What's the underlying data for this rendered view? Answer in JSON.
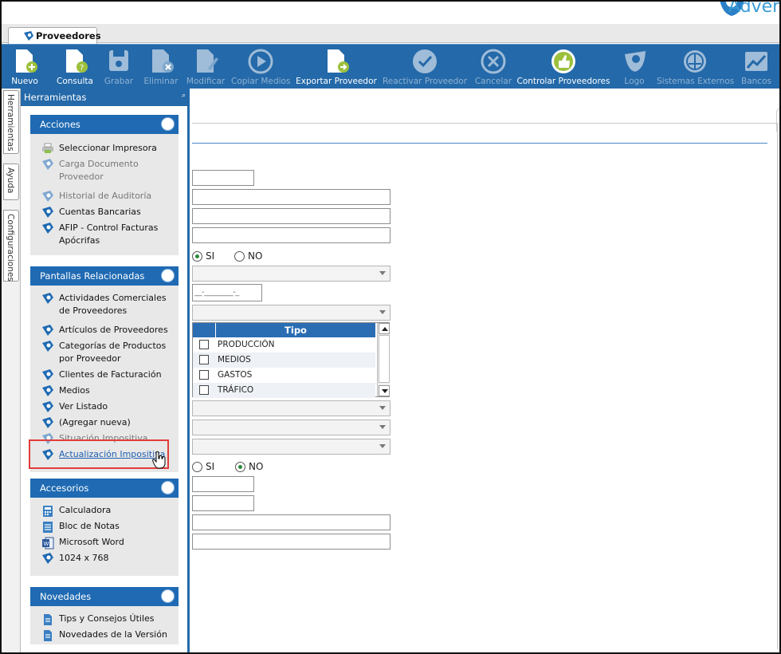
{
  "brand": {
    "logo_text": "Adver"
  },
  "window_tab": {
    "label": "Proveedores"
  },
  "toolbar": [
    {
      "label": "Nuevo",
      "icon": "doc-add-icon",
      "enabled": true
    },
    {
      "label": "Consulta",
      "icon": "doc-query-icon",
      "enabled": true
    },
    {
      "label": "Grabar",
      "icon": "save-icon",
      "enabled": false
    },
    {
      "label": "Eliminar",
      "icon": "doc-delete-icon",
      "enabled": false
    },
    {
      "label": "Modificar",
      "icon": "doc-edit-icon",
      "enabled": false
    },
    {
      "label": "Copiar Medios",
      "icon": "play-icon",
      "enabled": false
    },
    {
      "label": "Exportar Proveedor",
      "icon": "doc-export-icon",
      "enabled": true
    },
    {
      "label": "Reactivar Proveedor",
      "icon": "check-icon",
      "enabled": false
    },
    {
      "label": "Cancelar",
      "icon": "cancel-icon",
      "enabled": false
    },
    {
      "label": "Controlar Proveedores",
      "icon": "thumbs-up-icon",
      "enabled": true
    },
    {
      "label": "Logo",
      "icon": "logo-icon",
      "enabled": false
    },
    {
      "label": "Sistemas Externos",
      "icon": "external-systems-icon",
      "enabled": false
    },
    {
      "label": "Bancos",
      "icon": "chart-icon",
      "enabled": false
    }
  ],
  "side_tabs": [
    "Herramientas",
    "Ayuda",
    "Configuraciones"
  ],
  "panel": {
    "title": "Herramientas",
    "groups": [
      {
        "title": "Acciones",
        "items": [
          {
            "label": "Seleccionar Impresora",
            "enabled": true,
            "icon": "printer-icon"
          },
          {
            "label": "Carga Documento Proveedor",
            "enabled": false,
            "icon": "app-icon"
          },
          {
            "label": "Historial de Auditoría",
            "enabled": false,
            "icon": "app-icon"
          },
          {
            "label": "Cuentas Bancarias",
            "enabled": true,
            "icon": "app-icon"
          },
          {
            "label": "AFIP - Control Facturas Apócrifas",
            "enabled": true,
            "icon": "app-icon"
          }
        ]
      },
      {
        "title": "Pantallas Relacionadas",
        "items": [
          {
            "label": "Actividades Comerciales de Proveedores",
            "enabled": true,
            "icon": "app-icon"
          },
          {
            "label": "Artículos de Proveedores",
            "enabled": true,
            "icon": "app-icon"
          },
          {
            "label": "Categorías de Productos por Proveedor",
            "enabled": true,
            "icon": "app-icon"
          },
          {
            "label": "Clientes de Facturación",
            "enabled": true,
            "icon": "app-icon"
          },
          {
            "label": "Medios",
            "enabled": true,
            "icon": "app-icon"
          },
          {
            "label": "Ver Listado",
            "enabled": true,
            "icon": "app-icon"
          },
          {
            "label": "(Agregar nueva)",
            "enabled": true,
            "icon": "app-icon"
          },
          {
            "label": "Situación Impositiva",
            "enabled": false,
            "icon": "app-icon"
          },
          {
            "label": "Actualización Impositiva",
            "enabled": true,
            "icon": "app-icon",
            "link": true
          }
        ]
      },
      {
        "title": "Accesorios",
        "items": [
          {
            "label": "Calculadora",
            "enabled": true,
            "icon": "calculator-icon"
          },
          {
            "label": "Bloc de Notas",
            "enabled": true,
            "icon": "notepad-icon"
          },
          {
            "label": "Microsoft Word",
            "enabled": true,
            "icon": "word-icon"
          },
          {
            "label": "1024 x 768",
            "enabled": true,
            "icon": "app-icon"
          }
        ]
      },
      {
        "title": "Novedades",
        "items": [
          {
            "label": "Tips y Consejos Útiles",
            "enabled": true,
            "icon": "document-icon"
          },
          {
            "label": "Novedades de la Versión",
            "enabled": true,
            "icon": "document-icon"
          }
        ]
      }
    ]
  },
  "form": {
    "radio1": {
      "options": [
        "SI",
        "NO"
      ],
      "selected": "SI"
    },
    "radio2": {
      "options": [
        "SI",
        "NO"
      ],
      "selected": "NO"
    },
    "masked_input": "__-________-_",
    "tipo_grid": {
      "header": "Tipo",
      "rows": [
        "PRODUCCIÓN",
        "MEDIOS",
        "GASTOS",
        "TRÁFICO"
      ]
    }
  },
  "colors": {
    "toolbar_bg": "#2469a9",
    "group_header": "#1f6ab3",
    "highlight": "#e23b3b"
  }
}
